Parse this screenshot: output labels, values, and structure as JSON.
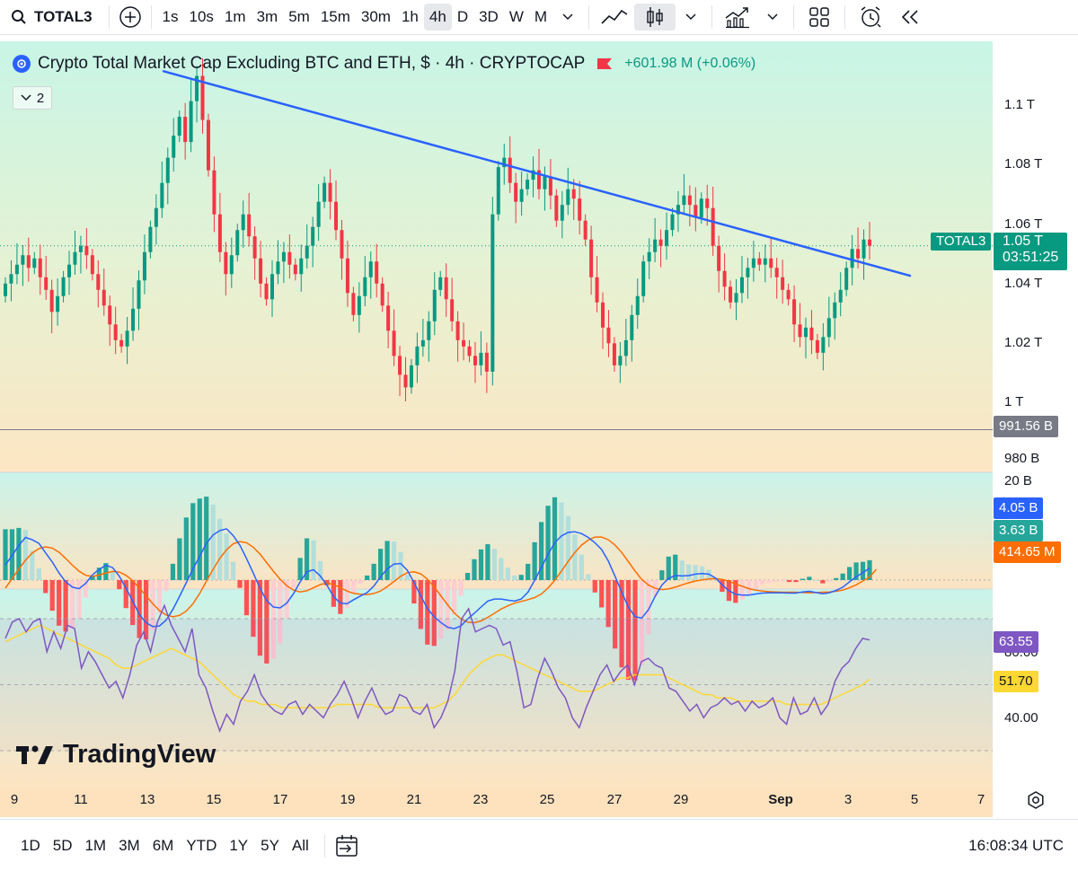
{
  "toolbar": {
    "symbol": "TOTAL3",
    "intervals": [
      "1s",
      "10s",
      "1m",
      "3m",
      "5m",
      "15m",
      "30m",
      "1h",
      "4h",
      "D",
      "3D",
      "W",
      "M"
    ],
    "active_interval": "4h"
  },
  "legend": {
    "title": "Crypto Total Market Cap Excluding BTC and ETH, $ · 4h · CRYPTOCAP",
    "change": "+601.98 M (+0.06%)",
    "indicator_count": "2"
  },
  "price_axis": {
    "ticks": [
      "1.1 T",
      "1.08 T",
      "1.06 T",
      "1.04 T",
      "1.02 T",
      "1 T",
      "980 B"
    ],
    "last_label": "TOTAL3",
    "last_value": "1.05 T",
    "countdown": "03:51:25",
    "hline_value": "991.56 B"
  },
  "macd_axis": {
    "top_tick": "20 B",
    "macd": "4.05 B",
    "signal": "3.63 B",
    "histogram": "414.65 M"
  },
  "rsi_axis": {
    "ticks": [
      "80.00",
      "40.00"
    ],
    "rsi": "63.55",
    "rsi_ma": "51.70"
  },
  "time_axis": {
    "labels": [
      "9",
      "11",
      "13",
      "15",
      "17",
      "19",
      "21",
      "23",
      "25",
      "27",
      "29",
      "Sep",
      "3",
      "5",
      "7"
    ]
  },
  "bottom_bar": {
    "ranges": [
      "1D",
      "5D",
      "1M",
      "3M",
      "6M",
      "YTD",
      "1Y",
      "5Y",
      "All"
    ],
    "clock": "16:08:34 UTC"
  },
  "watermark": "TradingView",
  "colors": {
    "up": "#089981",
    "down": "#f23645",
    "trendline": "#2962ff",
    "macd": "#2962ff",
    "signal": "#ff6d00",
    "rsi": "#7e57c2",
    "rsi_ma": "#fdd835"
  },
  "chart_data": {
    "type": "candlestick",
    "interval": "4h",
    "ylim": [
      0.978,
      1.115
    ],
    "price_unit": "T USD",
    "horizontal_line": 0.99156,
    "trendline": {
      "start": 1.1055,
      "end": 1.0405
    },
    "series": [
      {
        "name": "TOTAL3",
        "closes": [
          1.038,
          1.041,
          1.044,
          1.047,
          1.043,
          1.046,
          1.04,
          1.036,
          1.029,
          1.034,
          1.04,
          1.044,
          1.048,
          1.05,
          1.047,
          1.041,
          1.036,
          1.031,
          1.025,
          1.02,
          1.018,
          1.023,
          1.03,
          1.039,
          1.048,
          1.056,
          1.062,
          1.07,
          1.078,
          1.085,
          1.091,
          1.083,
          1.096,
          1.104,
          1.09,
          1.074,
          1.06,
          1.048,
          1.041,
          1.047,
          1.055,
          1.06,
          1.053,
          1.046,
          1.038,
          1.033,
          1.041,
          1.045,
          1.048,
          1.044,
          1.041,
          1.046,
          1.05,
          1.056,
          1.064,
          1.07,
          1.064,
          1.055,
          1.046,
          1.035,
          1.028,
          1.034,
          1.04,
          1.045,
          1.038,
          1.031,
          1.023,
          1.015,
          1.009,
          1.005,
          1.012,
          1.018,
          1.02,
          1.026,
          1.036,
          1.04,
          1.033,
          1.026,
          1.02,
          1.018,
          1.015,
          1.012,
          1.016,
          1.01,
          1.06,
          1.075,
          1.078,
          1.07,
          1.064,
          1.068,
          1.071,
          1.074,
          1.068,
          1.072,
          1.066,
          1.058,
          1.063,
          1.068,
          1.065,
          1.058,
          1.052,
          1.04,
          1.032,
          1.024,
          1.019,
          1.012,
          1.015,
          1.02,
          1.028,
          1.034,
          1.045,
          1.048,
          1.052,
          1.05,
          1.055,
          1.06,
          1.063,
          1.066,
          1.063,
          1.059,
          1.065,
          1.062,
          1.05,
          1.042,
          1.037,
          1.032,
          1.035,
          1.04,
          1.043,
          1.046,
          1.044,
          1.046,
          1.043,
          1.04,
          1.036,
          1.033,
          1.025,
          1.021,
          1.024,
          1.02,
          1.016,
          1.021,
          1.027,
          1.032,
          1.036,
          1.043,
          1.049,
          1.046,
          1.052,
          1.05
        ]
      }
    ],
    "macd": {
      "values": [
        5.1,
        8.3,
        11.7,
        14.4,
        13.6,
        12.4,
        9.2,
        6.1,
        2.4,
        -0.6,
        -2.4,
        -2.9,
        -1.1,
        1.8,
        3.6,
        5.0,
        4.2,
        1.3,
        -2.7,
        -7.1,
        -11.6,
        -14.4,
        -15.7,
        -15.5,
        -13.5,
        -9.9,
        -5.5,
        -0.9,
        3.8,
        8.0,
        12.4,
        15.2,
        16.7,
        17.3,
        15.0,
        11.8,
        7.2,
        2.4,
        -2.8,
        -6.9,
        -9.1,
        -9.4,
        -7.8,
        -4.6,
        -0.6,
        2.8,
        3.5,
        1.4,
        -1.8,
        -5.6,
        -7.8,
        -8.0,
        -6.6,
        -5.4,
        -4.2,
        -2.0,
        1.1,
        3.8,
        5.4,
        5.6,
        3.3,
        -0.8,
        -5.4,
        -9.6,
        -12.4,
        -14.3,
        -15.9,
        -16.4,
        -15.5,
        -13.1,
        -11.2,
        -9.1,
        -7.1,
        -6.4,
        -6.4,
        -6.8,
        -7.1,
        -6.4,
        -4.1,
        -0.1,
        4.2,
        8.7,
        12.6,
        14.9,
        16.1,
        16.3,
        15.7,
        14.4,
        12.6,
        10.3,
        6.4,
        1.3,
        -4.1,
        -9.1,
        -12.4,
        -12.8,
        -10.0,
        -5.4,
        -1.7,
        0.6,
        1.5,
        1.4,
        1.5,
        2.0,
        2.2,
        2.0,
        0.7,
        -1.6,
        -3.6,
        -4.8,
        -5.1,
        -5.1,
        -4.7,
        -4.4,
        -4.3,
        -4.3,
        -4.3,
        -4.4,
        -4.4,
        -4.0,
        -3.8,
        -4.2,
        -4.6,
        -4.3,
        -3.5,
        -2.4,
        -0.6,
        1.1,
        2.5,
        4.05
      ]
    },
    "signal": {
      "values": [
        -2.7,
        0.5,
        3.7,
        6.7,
        9.1,
        10.6,
        11.2,
        10.8,
        9.4,
        7.3,
        5.0,
        3.0,
        1.6,
        1.2,
        1.7,
        2.4,
        2.9,
        2.7,
        1.6,
        -0.2,
        -2.7,
        -5.3,
        -8.0,
        -10.3,
        -11.8,
        -12.4,
        -11.9,
        -10.5,
        -8.0,
        -4.5,
        -0.4,
        3.6,
        7.3,
        10.2,
        12.2,
        13.0,
        12.6,
        11.1,
        8.8,
        5.9,
        3.0,
        0.3,
        -1.9,
        -3.4,
        -4.0,
        -3.6,
        -2.6,
        -1.5,
        -1.0,
        -1.5,
        -2.6,
        -3.7,
        -4.5,
        -4.8,
        -4.9,
        -4.5,
        -3.7,
        -2.2,
        -0.5,
        1.3,
        2.5,
        2.8,
        2.1,
        0.3,
        -2.3,
        -5.3,
        -8.3,
        -11.1,
        -13.1,
        -14.2,
        -14.4,
        -13.8,
        -12.6,
        -11.2,
        -9.8,
        -8.7,
        -7.8,
        -7.2,
        -6.6,
        -5.9,
        -4.7,
        -2.7,
        -0.1,
        3.0,
        6.3,
        9.3,
        11.8,
        13.5,
        14.5,
        14.5,
        13.6,
        11.8,
        9.3,
        6.2,
        3.0,
        0.2,
        -1.7,
        -2.8,
        -3.2,
        -3.0,
        -2.4,
        -1.6,
        -0.9,
        -0.3,
        0.1,
        0.4,
        0.5,
        0.2,
        -0.4,
        -1.3,
        -2.1,
        -2.9,
        -3.4,
        -3.7,
        -3.9,
        -4.0,
        -4.1,
        -4.1,
        -4.1,
        -4.2,
        -4.3,
        -4.2,
        -4.1,
        -4.0,
        -3.8,
        -3.4,
        -2.6,
        -1.6,
        -0.3,
        1.0,
        3.63
      ]
    },
    "rsi": {
      "values": [
        64,
        69,
        70,
        66,
        69,
        70,
        60,
        66,
        61,
        68,
        67,
        55,
        60,
        57,
        53,
        49,
        51,
        46,
        53,
        62,
        66,
        60,
        69,
        74,
        68,
        64,
        60,
        67,
        53,
        49,
        42,
        36,
        41,
        38,
        45,
        48,
        53,
        47,
        44,
        42,
        41,
        44,
        45,
        41,
        44,
        42,
        40,
        44,
        47,
        51,
        46,
        40,
        45,
        49,
        44,
        41,
        42,
        47,
        46,
        42,
        41,
        44,
        37,
        40,
        45,
        54,
        70,
        73,
        66,
        67,
        68,
        67,
        62,
        63,
        54,
        43,
        44,
        52,
        58,
        54,
        49,
        46,
        40,
        37,
        43,
        48,
        53,
        56,
        51,
        54,
        56,
        50,
        57,
        58,
        56,
        55,
        49,
        48,
        45,
        42,
        44,
        40,
        43,
        44,
        46,
        44,
        45,
        42,
        45,
        43,
        44,
        46,
        40,
        38,
        46,
        41,
        42,
        46,
        41,
        44,
        51,
        55,
        57,
        61,
        64,
        63.55
      ]
    },
    "rsi_ma": {
      "values": [
        63,
        64,
        65,
        66,
        67,
        68,
        67,
        66,
        65,
        64,
        63,
        62,
        61,
        60,
        59,
        58,
        56,
        55,
        55,
        56,
        57,
        58,
        59,
        60,
        61,
        60,
        59,
        58,
        57,
        55,
        53,
        51,
        49,
        47,
        46,
        45,
        45,
        44,
        44,
        44,
        43,
        43,
        43,
        43,
        43,
        43,
        43,
        43,
        44,
        44,
        44,
        44,
        44,
        44,
        43,
        43,
        43,
        43,
        43,
        43,
        43,
        43,
        43,
        44,
        45,
        47,
        50,
        53,
        55,
        57,
        58,
        59,
        59,
        58,
        57,
        56,
        55,
        54,
        53,
        52,
        51,
        50,
        49,
        48,
        48,
        48,
        49,
        50,
        51,
        52,
        52,
        53,
        53,
        53,
        53,
        53,
        52,
        51,
        50,
        49,
        48,
        47,
        47,
        46,
        46,
        46,
        45,
        45,
        45,
        45,
        45,
        45,
        45,
        44,
        44,
        44,
        44,
        44,
        44,
        45,
        46,
        47,
        48,
        49,
        50,
        51.7
      ]
    },
    "rsi_levels": [
      70,
      50,
      30
    ]
  }
}
